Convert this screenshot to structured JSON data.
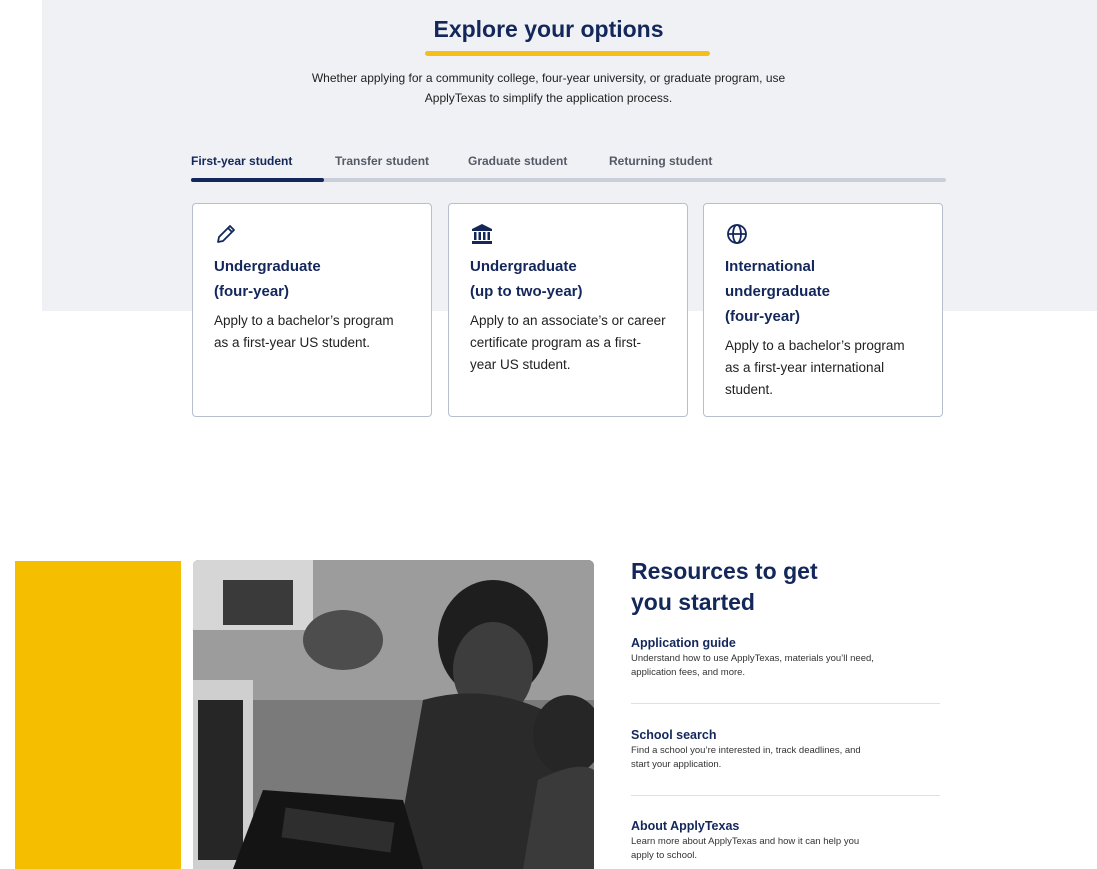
{
  "explore": {
    "title": "Explore your options",
    "description": "Whether applying for a community college, four-year university, or graduate program, use ApplyTexas to simplify the application process."
  },
  "tabs": [
    {
      "label": "First-year student",
      "active": true
    },
    {
      "label": "Transfer student",
      "active": false
    },
    {
      "label": "Graduate student",
      "active": false
    },
    {
      "label": "Returning student",
      "active": false
    }
  ],
  "cards": [
    {
      "icon": "pencil-icon",
      "title_line1": "Undergraduate",
      "title_line2": "(four-year)",
      "title_line3": "",
      "text": "Apply to a bachelor’s program as a first-year US student."
    },
    {
      "icon": "institution-icon",
      "title_line1": "Undergraduate",
      "title_line2": "(up to two-year)",
      "title_line3": "",
      "text": "Apply to an associate’s or career certificate program as a first-year US student."
    },
    {
      "icon": "globe-icon",
      "title_line1": "International",
      "title_line2": "undergraduate",
      "title_line3": "(four-year)",
      "text": "Apply to a bachelor’s program as a first-year international student."
    }
  ],
  "resources": {
    "title_line1": "Resources to get",
    "title_line2": "you started",
    "items": [
      {
        "title": "Application guide",
        "text": "Understand how to use ApplyTexas, materials you’ll need, application fees, and more."
      },
      {
        "title": "School search",
        "text": "Find a school you’re interested in, track deadlines, and start your application."
      },
      {
        "title": "About ApplyTexas",
        "text": "Learn more about ApplyTexas and how it can help you apply to school."
      }
    ]
  },
  "colors": {
    "brand_navy": "#13275b",
    "accent_yellow": "#f5bf1a",
    "band_gray": "#f0f1f5"
  }
}
